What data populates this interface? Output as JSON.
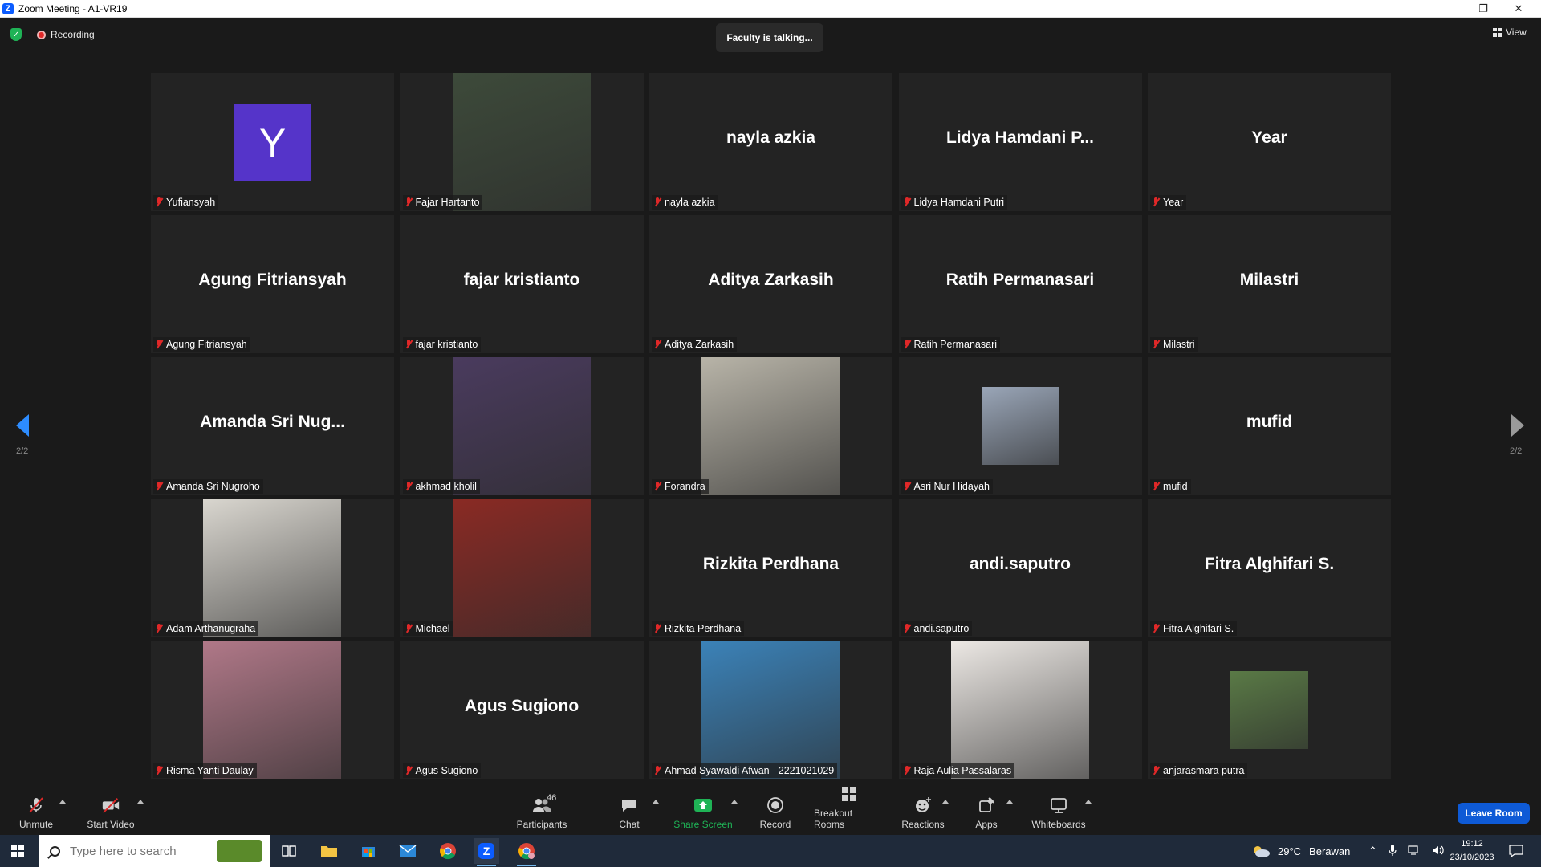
{
  "window": {
    "title": "Zoom Meeting - A1-VR19",
    "app_logo": "Z",
    "controls": [
      "minimize-icon",
      "restore-icon",
      "close-icon"
    ]
  },
  "topbar": {
    "recording_label": "Recording",
    "talking_banner": "Faculty is talking...",
    "view_label": "View"
  },
  "pagination": {
    "left": "2/2",
    "right": "2/2"
  },
  "tiles": [
    {
      "display": "Y",
      "label": "Yufiansyah",
      "kind": "avatar-letter",
      "color": "#5534c9"
    },
    {
      "display": "",
      "label": "Fajar Hartanto",
      "kind": "photo",
      "color": "#3d4a3a"
    },
    {
      "display": "nayla azkia",
      "label": "nayla azkia",
      "kind": "name"
    },
    {
      "display": "Lidya Hamdani P...",
      "label": "Lidya Hamdani Putri",
      "kind": "name"
    },
    {
      "display": "Year",
      "label": "Year",
      "kind": "name"
    },
    {
      "display": "Agung Fitriansyah",
      "label": "Agung Fitriansyah",
      "kind": "name"
    },
    {
      "display": "fajar kristianto",
      "label": "fajar kristianto",
      "kind": "name"
    },
    {
      "display": "Aditya Zarkasih",
      "label": "Aditya Zarkasih",
      "kind": "name"
    },
    {
      "display": "Ratih Permanasari",
      "label": "Ratih Permanasari",
      "kind": "name"
    },
    {
      "display": "Milastri",
      "label": "Milastri",
      "kind": "name"
    },
    {
      "display": "Amanda Sri Nug...",
      "label": "Amanda Sri Nugroho",
      "kind": "name"
    },
    {
      "display": "",
      "label": "akhmad kholil",
      "kind": "photo",
      "color": "#4a3b5e"
    },
    {
      "display": "",
      "label": "Forandra",
      "kind": "photo",
      "color": "#b8b4a8"
    },
    {
      "display": "",
      "label": "Asri Nur Hidayah",
      "kind": "photo-small",
      "color": "#9aa6b8"
    },
    {
      "display": "mufid",
      "label": "mufid",
      "kind": "name"
    },
    {
      "display": "",
      "label": "Adam Arthanugraha",
      "kind": "photo",
      "color": "#d9d6cf"
    },
    {
      "display": "",
      "label": "Michael",
      "kind": "photo",
      "color": "#8a2a24"
    },
    {
      "display": "Rizkita Perdhana",
      "label": "Rizkita Perdhana",
      "kind": "name"
    },
    {
      "display": "andi.saputro",
      "label": "andi.saputro",
      "kind": "name"
    },
    {
      "display": "Fitra Alghifari S.",
      "label": "Fitra Alghifari S.",
      "kind": "name"
    },
    {
      "display": "",
      "label": "Risma Yanti Daulay",
      "kind": "photo",
      "color": "#b07888"
    },
    {
      "display": "Agus Sugiono",
      "label": "Agus Sugiono",
      "kind": "name"
    },
    {
      "display": "",
      "label": "Ahmad Syawaldi Afwan - 2221021029",
      "kind": "photo",
      "color": "#3b82b8"
    },
    {
      "display": "",
      "label": "Raja Aulia Passalaras",
      "kind": "photo",
      "color": "#ece8e4"
    },
    {
      "display": "",
      "label": "anjarasmara putra",
      "kind": "photo-small",
      "color": "#5a7a46"
    }
  ],
  "toolbar": {
    "unmute": "Unmute",
    "start_video": "Start Video",
    "participants": "Participants",
    "participants_count": "46",
    "chat": "Chat",
    "share_screen": "Share Screen",
    "record": "Record",
    "breakout_rooms": "Breakout Rooms",
    "reactions": "Reactions",
    "apps": "Apps",
    "whiteboards": "Whiteboards",
    "leave": "Leave Room",
    "share_color": "#1fb356",
    "leave_color": "#0e5ad6"
  },
  "taskbar": {
    "search_placeholder": "Type here to search",
    "weather_temp": "29°C",
    "weather_text": "Berawan",
    "time": "19:12",
    "date": "23/10/2023"
  }
}
